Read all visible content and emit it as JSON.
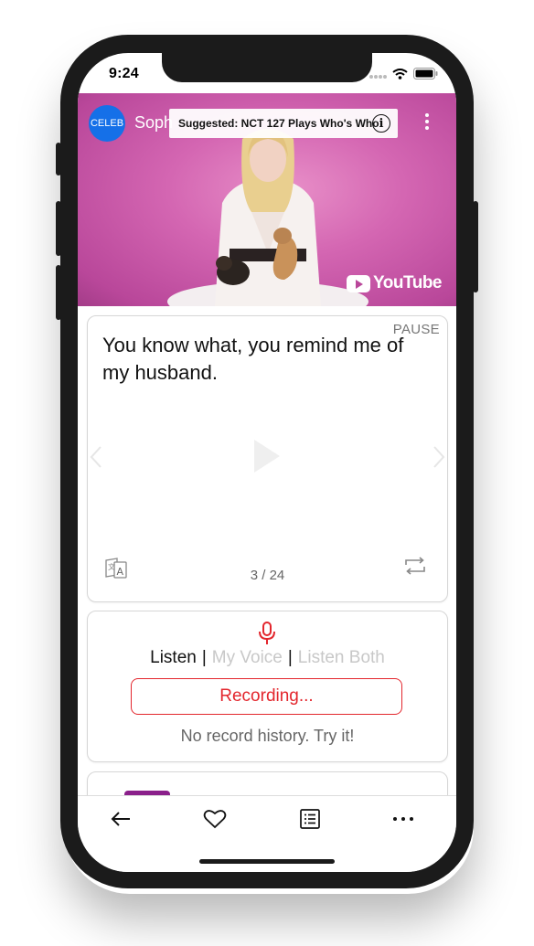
{
  "status_bar": {
    "time": "9:24"
  },
  "video": {
    "channel_logo_text": "CELEB",
    "channel_name": "Soph",
    "suggested": "Suggested: NCT 127 Plays Who's Who",
    "brand": "YouTube",
    "background_color": "#d466b2"
  },
  "subtitle_card": {
    "pause_label": "PAUSE",
    "text": "You know what, you remind me of my husband.",
    "counter": "3 / 24"
  },
  "record_card": {
    "modes": [
      "Listen",
      "My Voice",
      "Listen Both"
    ],
    "separator": "|",
    "recording_label": "Recording...",
    "empty_message": "No record history. Try it!",
    "accent_color": "#e3262d"
  },
  "tabbar": {
    "icons": [
      "back-arrow-icon",
      "heart-icon",
      "list-icon",
      "more-icon"
    ]
  }
}
